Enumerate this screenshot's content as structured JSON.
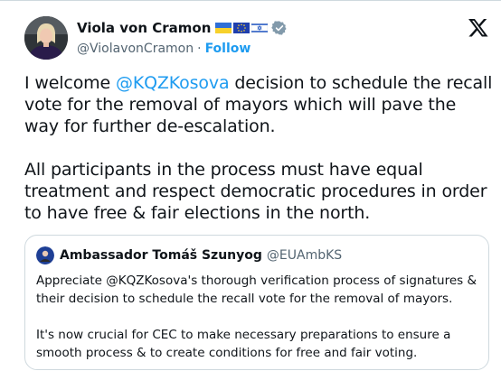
{
  "author": {
    "name": "Viola von Cramon",
    "handle": "@ViolavonCramon",
    "separator": "·",
    "follow_label": "Follow"
  },
  "tweet": {
    "para1_before": "I welcome ",
    "para1_mention": "@KQZKosova",
    "para1_after": " decision to schedule the recall vote for the removal of mayors which will pave the way for further de-escalation.",
    "para2": "All participants in the process must have equal treatment and respect democratic procedures in order to have free & fair elections in the north."
  },
  "quoted": {
    "name": "Ambassador Tomáš Szunyog",
    "handle": "@EUAmbKS",
    "para1": "Appreciate @KQZKosova's thorough verification process of signatures & their decision to schedule the recall vote for the removal of mayors.",
    "para2": "It's now crucial for CEC to make necessary preparations to ensure a smooth process & to create conditions for free and fair voting."
  },
  "icons": {
    "flags": [
      "ukraine-flag",
      "eu-flag",
      "israel-flag"
    ],
    "verified": "verified-badge-icon",
    "platform": "x-logo-icon"
  },
  "colors": {
    "accent": "#1d9bf0",
    "text": "#0f1419",
    "muted": "#536471",
    "border": "#cfd9de"
  }
}
